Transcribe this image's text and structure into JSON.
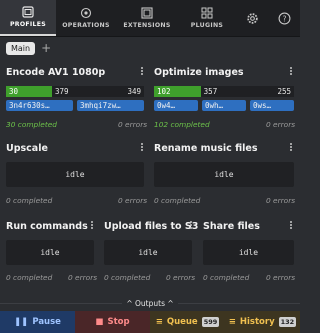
{
  "nav": {
    "tabs": [
      {
        "label": "PROFILES",
        "icon": "profiles-icon"
      },
      {
        "label": "OPERATIONS",
        "icon": "operations-icon"
      },
      {
        "label": "EXTENSIONS",
        "icon": "extensions-icon"
      },
      {
        "label": "PLUGINS",
        "icon": "plugins-icon"
      }
    ],
    "settings_icon": "gear-icon",
    "help_icon": "help-icon"
  },
  "tabs": {
    "main": "Main",
    "add": "+"
  },
  "profiles": [
    {
      "title": "Encode AV1 1080p",
      "metrics": [
        "30",
        "379",
        "349"
      ],
      "chips": [
        "3n4r630s…",
        "3mhqi7zw…"
      ],
      "completed": "30 completed",
      "errors": "0 errors"
    },
    {
      "title": "Optimize images",
      "metrics": [
        "102",
        "357",
        "255"
      ],
      "chips": [
        "0w4…",
        "0wh…",
        "0ws…"
      ],
      "completed": "102 completed",
      "errors": "0 errors"
    },
    {
      "title": "Upscale",
      "status": "idle",
      "completed": "0 completed",
      "errors": "0 errors"
    },
    {
      "title": "Rename music files",
      "status": "idle",
      "completed": "0 completed",
      "errors": "0 errors"
    },
    {
      "title": "Run commands",
      "status": "idle",
      "completed": "0 completed",
      "errors": "0 errors"
    },
    {
      "title": "Upload files to S3",
      "status": "idle",
      "completed": "0 completed",
      "errors": "0 errors"
    },
    {
      "title": "Share files",
      "status": "idle",
      "completed": "0 completed",
      "errors": "0 errors"
    }
  ],
  "outputs": {
    "label": "Outputs"
  },
  "controls": {
    "pause": "Pause",
    "stop": "Stop",
    "queue": "Queue",
    "queue_count": "599",
    "history": "History",
    "history_count": "132"
  },
  "colors": {
    "accent_green": "#3fa02c",
    "chip_blue": "#2e6fc0",
    "pause": "#9fc4ff",
    "stop": "#ff8b8b",
    "queue": "#f0c050"
  }
}
